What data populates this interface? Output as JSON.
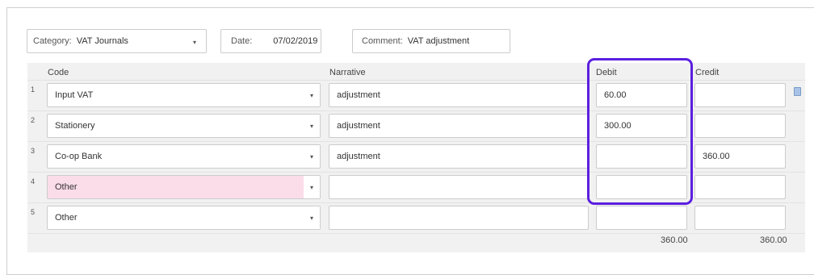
{
  "header": {
    "category_label": "Category:",
    "category_value": "VAT Journals",
    "date_label": "Date:",
    "date_value": "07/02/2019",
    "comment_label": "Comment:",
    "comment_value": "VAT adjustment"
  },
  "columns": {
    "code": "Code",
    "narrative": "Narrative",
    "debit": "Debit",
    "credit": "Credit"
  },
  "rows": [
    {
      "num": "1",
      "code": "Input VAT",
      "narrative": "adjustment",
      "debit": "60.00",
      "credit": ""
    },
    {
      "num": "2",
      "code": "Stationery",
      "narrative": "adjustment",
      "debit": "300.00",
      "credit": ""
    },
    {
      "num": "3",
      "code": "Co-op Bank",
      "narrative": "adjustment",
      "debit": "",
      "credit": "360.00"
    },
    {
      "num": "4",
      "code": "Other",
      "narrative": "",
      "debit": "",
      "credit": ""
    },
    {
      "num": "5",
      "code": "Other",
      "narrative": "",
      "debit": "",
      "credit": ""
    }
  ],
  "totals": {
    "debit": "360.00",
    "credit": "360.00"
  },
  "colors": {
    "highlight": "#5b1fe0",
    "invalid_row": "#fbdde9"
  },
  "icons": {
    "dropdown": "▾",
    "row_note": "note-icon"
  }
}
